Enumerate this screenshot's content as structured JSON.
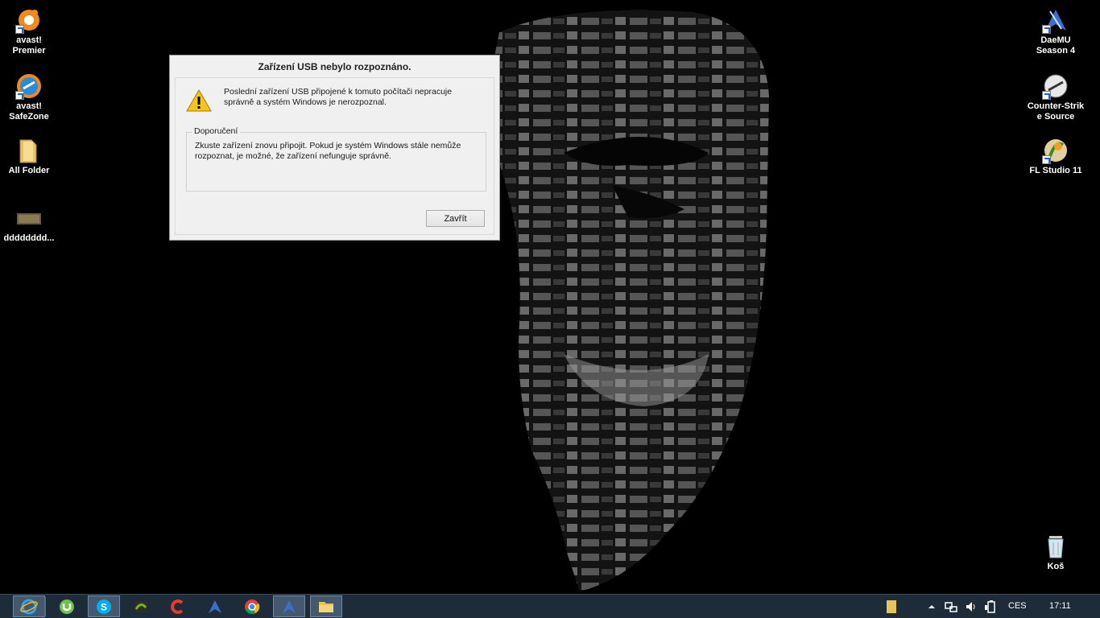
{
  "desktop": {
    "icons_left": [
      {
        "name": "avast-premier",
        "line1": "avast!",
        "line2": "Premier"
      },
      {
        "name": "avast-safezone",
        "line1": "avast!",
        "line2": "SafeZone"
      },
      {
        "name": "all-folder",
        "line1": "All Folder",
        "line2": ""
      },
      {
        "name": "dddd-file",
        "line1": "dddddddd...",
        "line2": ""
      }
    ],
    "icons_right": [
      {
        "name": "daemu",
        "line1": "DaeMU",
        "line2": "Season 4"
      },
      {
        "name": "counter-strike",
        "line1": "Counter-Strik",
        "line2": "e Source"
      },
      {
        "name": "fl-studio",
        "line1": "FL Studio 11",
        "line2": ""
      },
      {
        "name": "recycle-bin",
        "line1": "Koš",
        "line2": ""
      }
    ]
  },
  "dialog": {
    "title": "Zařízení USB nebylo rozpoznáno.",
    "message": "Poslední zařízení USB připojené k tomuto počítači nepracuje správně a systém Windows je nerozpoznal.",
    "group_title": "Doporučení",
    "group_text": "Zkuste zařízení znovu připojit. Pokud je systém Windows stále nemůže rozpoznat, je možné, že zařízení nefunguje správně.",
    "close_label": "Zavřít"
  },
  "taskbar": {
    "language": "CES",
    "time": "17:11",
    "accent": "#1e2c3a"
  }
}
